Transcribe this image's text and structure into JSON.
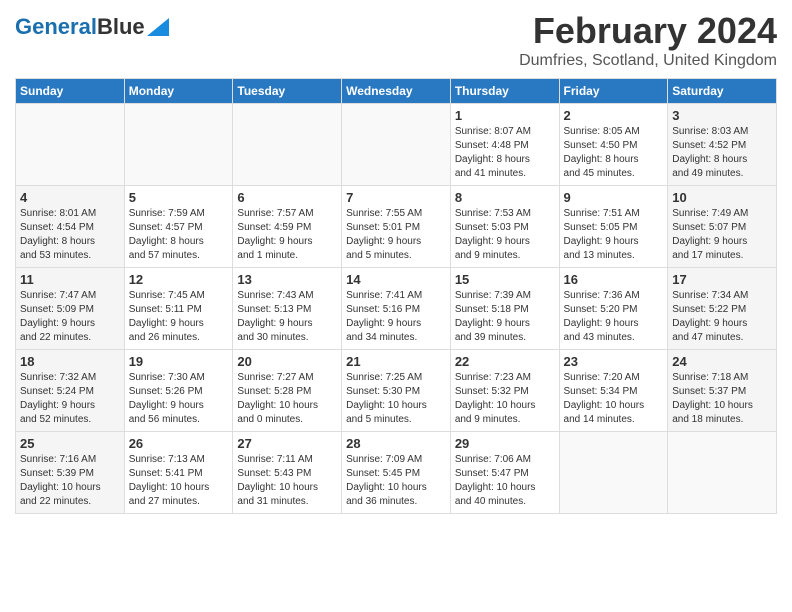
{
  "logo": {
    "part1": "General",
    "part2": "Blue"
  },
  "title": "February 2024",
  "location": "Dumfries, Scotland, United Kingdom",
  "days_of_week": [
    "Sunday",
    "Monday",
    "Tuesday",
    "Wednesday",
    "Thursday",
    "Friday",
    "Saturday"
  ],
  "weeks": [
    [
      {
        "day": "",
        "info": ""
      },
      {
        "day": "",
        "info": ""
      },
      {
        "day": "",
        "info": ""
      },
      {
        "day": "",
        "info": ""
      },
      {
        "day": "1",
        "info": "Sunrise: 8:07 AM\nSunset: 4:48 PM\nDaylight: 8 hours\nand 41 minutes."
      },
      {
        "day": "2",
        "info": "Sunrise: 8:05 AM\nSunset: 4:50 PM\nDaylight: 8 hours\nand 45 minutes."
      },
      {
        "day": "3",
        "info": "Sunrise: 8:03 AM\nSunset: 4:52 PM\nDaylight: 8 hours\nand 49 minutes."
      }
    ],
    [
      {
        "day": "4",
        "info": "Sunrise: 8:01 AM\nSunset: 4:54 PM\nDaylight: 8 hours\nand 53 minutes."
      },
      {
        "day": "5",
        "info": "Sunrise: 7:59 AM\nSunset: 4:57 PM\nDaylight: 8 hours\nand 57 minutes."
      },
      {
        "day": "6",
        "info": "Sunrise: 7:57 AM\nSunset: 4:59 PM\nDaylight: 9 hours\nand 1 minute."
      },
      {
        "day": "7",
        "info": "Sunrise: 7:55 AM\nSunset: 5:01 PM\nDaylight: 9 hours\nand 5 minutes."
      },
      {
        "day": "8",
        "info": "Sunrise: 7:53 AM\nSunset: 5:03 PM\nDaylight: 9 hours\nand 9 minutes."
      },
      {
        "day": "9",
        "info": "Sunrise: 7:51 AM\nSunset: 5:05 PM\nDaylight: 9 hours\nand 13 minutes."
      },
      {
        "day": "10",
        "info": "Sunrise: 7:49 AM\nSunset: 5:07 PM\nDaylight: 9 hours\nand 17 minutes."
      }
    ],
    [
      {
        "day": "11",
        "info": "Sunrise: 7:47 AM\nSunset: 5:09 PM\nDaylight: 9 hours\nand 22 minutes."
      },
      {
        "day": "12",
        "info": "Sunrise: 7:45 AM\nSunset: 5:11 PM\nDaylight: 9 hours\nand 26 minutes."
      },
      {
        "day": "13",
        "info": "Sunrise: 7:43 AM\nSunset: 5:13 PM\nDaylight: 9 hours\nand 30 minutes."
      },
      {
        "day": "14",
        "info": "Sunrise: 7:41 AM\nSunset: 5:16 PM\nDaylight: 9 hours\nand 34 minutes."
      },
      {
        "day": "15",
        "info": "Sunrise: 7:39 AM\nSunset: 5:18 PM\nDaylight: 9 hours\nand 39 minutes."
      },
      {
        "day": "16",
        "info": "Sunrise: 7:36 AM\nSunset: 5:20 PM\nDaylight: 9 hours\nand 43 minutes."
      },
      {
        "day": "17",
        "info": "Sunrise: 7:34 AM\nSunset: 5:22 PM\nDaylight: 9 hours\nand 47 minutes."
      }
    ],
    [
      {
        "day": "18",
        "info": "Sunrise: 7:32 AM\nSunset: 5:24 PM\nDaylight: 9 hours\nand 52 minutes."
      },
      {
        "day": "19",
        "info": "Sunrise: 7:30 AM\nSunset: 5:26 PM\nDaylight: 9 hours\nand 56 minutes."
      },
      {
        "day": "20",
        "info": "Sunrise: 7:27 AM\nSunset: 5:28 PM\nDaylight: 10 hours\nand 0 minutes."
      },
      {
        "day": "21",
        "info": "Sunrise: 7:25 AM\nSunset: 5:30 PM\nDaylight: 10 hours\nand 5 minutes."
      },
      {
        "day": "22",
        "info": "Sunrise: 7:23 AM\nSunset: 5:32 PM\nDaylight: 10 hours\nand 9 minutes."
      },
      {
        "day": "23",
        "info": "Sunrise: 7:20 AM\nSunset: 5:34 PM\nDaylight: 10 hours\nand 14 minutes."
      },
      {
        "day": "24",
        "info": "Sunrise: 7:18 AM\nSunset: 5:37 PM\nDaylight: 10 hours\nand 18 minutes."
      }
    ],
    [
      {
        "day": "25",
        "info": "Sunrise: 7:16 AM\nSunset: 5:39 PM\nDaylight: 10 hours\nand 22 minutes."
      },
      {
        "day": "26",
        "info": "Sunrise: 7:13 AM\nSunset: 5:41 PM\nDaylight: 10 hours\nand 27 minutes."
      },
      {
        "day": "27",
        "info": "Sunrise: 7:11 AM\nSunset: 5:43 PM\nDaylight: 10 hours\nand 31 minutes."
      },
      {
        "day": "28",
        "info": "Sunrise: 7:09 AM\nSunset: 5:45 PM\nDaylight: 10 hours\nand 36 minutes."
      },
      {
        "day": "29",
        "info": "Sunrise: 7:06 AM\nSunset: 5:47 PM\nDaylight: 10 hours\nand 40 minutes."
      },
      {
        "day": "",
        "info": ""
      },
      {
        "day": "",
        "info": ""
      }
    ]
  ]
}
